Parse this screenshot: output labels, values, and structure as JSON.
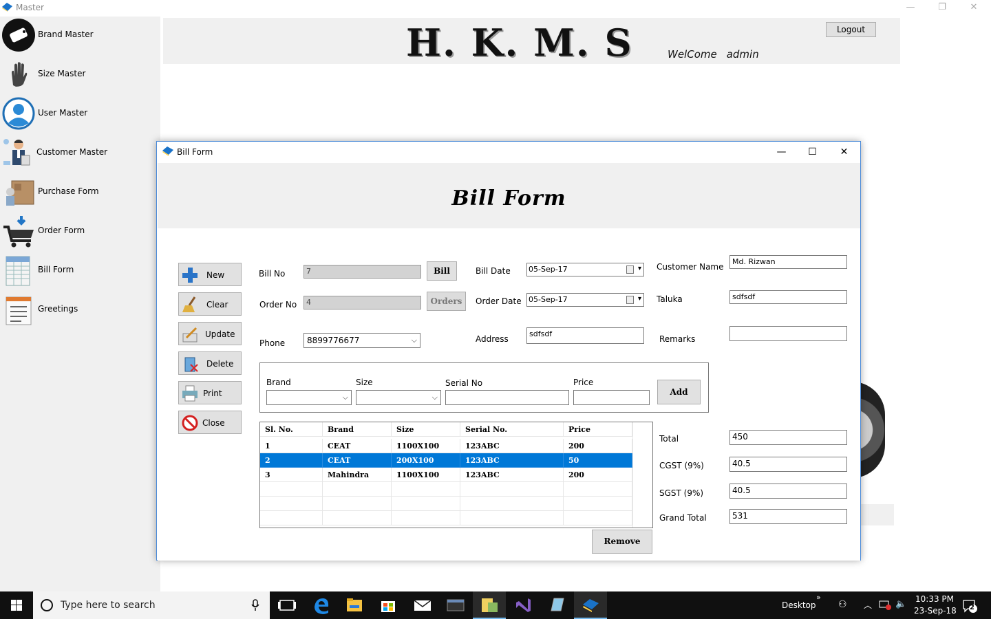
{
  "master": {
    "title": "Master",
    "heading": "H. K. M. S",
    "welcome_label": "WelCome",
    "username": "admin",
    "logout_label": "Logout"
  },
  "sidebar": {
    "items": [
      {
        "label": "Brand Master",
        "icon": "tag-icon"
      },
      {
        "label": "Size Master",
        "icon": "hand-icon"
      },
      {
        "label": "User Master",
        "icon": "user-icon"
      },
      {
        "label": "Customer Master",
        "icon": "customer-icon"
      },
      {
        "label": "Purchase Form",
        "icon": "boxes-icon"
      },
      {
        "label": "Order Form",
        "icon": "cart-icon"
      },
      {
        "label": "Bill Form",
        "icon": "spreadsheet-icon"
      },
      {
        "label": "Greetings",
        "icon": "document-icon"
      }
    ]
  },
  "bill_form": {
    "window_title": "Bill Form",
    "heading": "Bill Form",
    "actions": [
      {
        "label": "New",
        "icon": "plus-icon"
      },
      {
        "label": "Clear",
        "icon": "broom-icon"
      },
      {
        "label": "Update",
        "icon": "edit-icon"
      },
      {
        "label": "Delete",
        "icon": "trash-icon"
      },
      {
        "label": "Print",
        "icon": "printer-icon"
      },
      {
        "label": "Close",
        "icon": "no-entry-icon"
      }
    ],
    "fields": {
      "bill_no_label": "Bill No",
      "bill_no_value": "7",
      "bill_button": "Bill",
      "order_no_label": "Order No",
      "order_no_value": "4",
      "orders_button": "Orders",
      "phone_label": "Phone",
      "phone_value": "8899776677",
      "bill_date_label": "Bill Date",
      "bill_date_value": "05-Sep-17",
      "order_date_label": "Order Date",
      "order_date_value": "05-Sep-17",
      "address_label": "Address",
      "address_value": "sdfsdf",
      "customer_name_label": "Customer Name",
      "customer_name_value": "Md. Rizwan",
      "taluka_label": "Taluka",
      "taluka_value": "sdfsdf",
      "remarks_label": "Remarks",
      "remarks_value": ""
    },
    "item_entry": {
      "brand_label": "Brand",
      "size_label": "Size",
      "serial_label": "Serial No",
      "price_label": "Price",
      "add_button": "Add"
    },
    "grid": {
      "columns": [
        "Sl. No.",
        "Brand",
        "Size",
        "Serial No.",
        "Price"
      ],
      "rows": [
        [
          "1",
          "CEAT",
          "1100X100",
          "123ABC",
          "200"
        ],
        [
          "2",
          "CEAT",
          "200X100",
          "123ABC",
          "50"
        ],
        [
          "3",
          "Mahindra",
          "1100X100",
          "123ABC",
          "200"
        ]
      ],
      "selected_row": 1
    },
    "remove_button": "Remove",
    "totals": {
      "total_label": "Total",
      "total_value": "450",
      "cgst_label": "CGST (9%)",
      "cgst_value": "40.5",
      "sgst_label": "SGST (9%)",
      "sgst_value": "40.5",
      "grand_total_label": "Grand Total",
      "grand_total_value": "531"
    }
  },
  "taskbar": {
    "search_placeholder": "Type here to search",
    "desktop_label": "Desktop",
    "time": "10:33 PM",
    "date": "23-Sep-18",
    "notification_count": "2"
  }
}
